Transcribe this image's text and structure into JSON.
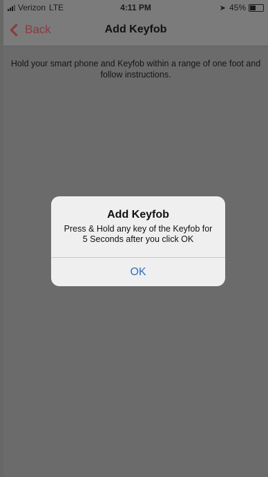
{
  "status_bar": {
    "carrier": "Verizon",
    "network": "LTE",
    "time": "4:11 PM",
    "battery_percent_label": "45%",
    "battery_level": 0.45,
    "location_icon": "location-arrow-icon",
    "signal_icon": "signal-bars-icon",
    "battery_icon": "battery-icon"
  },
  "nav": {
    "back_label": "Back",
    "title": "Add Keyfob",
    "accent_color": "#8a3a3f"
  },
  "content": {
    "instructions_line1": "Hold your smart phone and Keyfob within a range of one foot and",
    "instructions_line2": "follow instructions."
  },
  "alert": {
    "title": "Add Keyfob",
    "message_line1": "Press & Hold any key of the Keyfob for",
    "message_line2": "5 Seconds after you click OK",
    "ok_label": "OK",
    "ok_color": "#2f6fbd"
  }
}
